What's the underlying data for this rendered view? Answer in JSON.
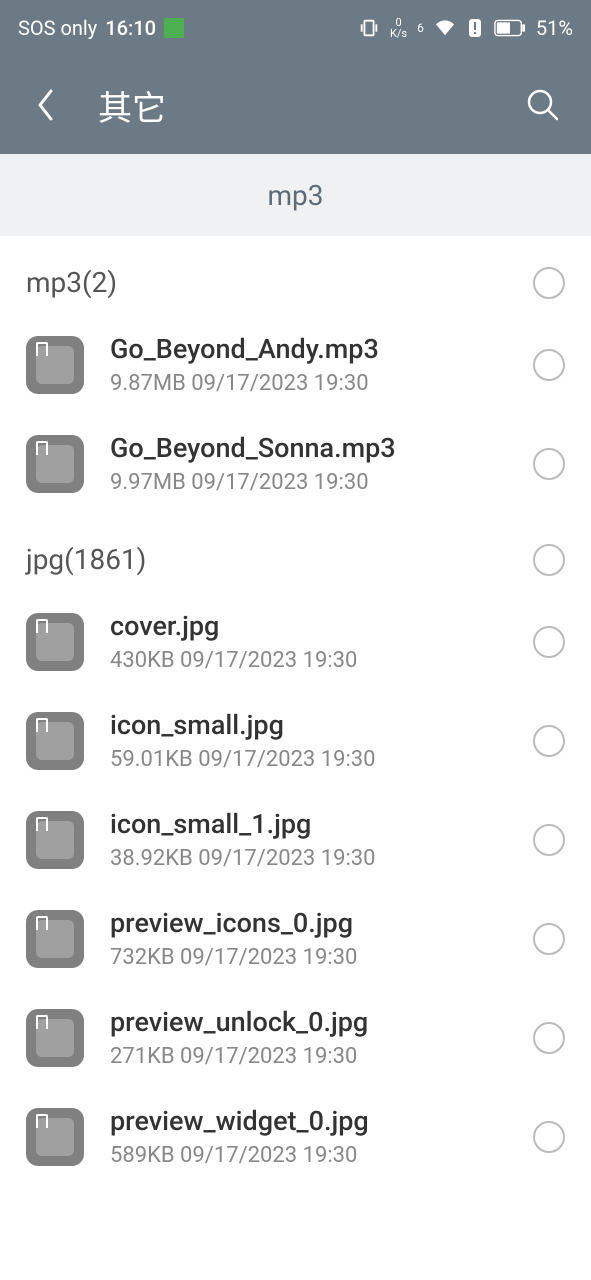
{
  "status_bar": {
    "network": "SOS only",
    "time": "16:10",
    "speed_top": "0",
    "speed_bottom": "K/s",
    "signal_count": "6",
    "battery": "51%"
  },
  "header": {
    "title": "其它"
  },
  "tab": {
    "active": "mp3"
  },
  "sections": [
    {
      "title": "mp3(2)",
      "files": [
        {
          "name": "Go_Beyond_Andy.mp3",
          "meta": "9.87MB 09/17/2023 19:30"
        },
        {
          "name": "Go_Beyond_Sonna.mp3",
          "meta": "9.97MB 09/17/2023 19:30"
        }
      ]
    },
    {
      "title": "jpg(1861)",
      "files": [
        {
          "name": "cover.jpg",
          "meta": "430KB 09/17/2023 19:30"
        },
        {
          "name": "icon_small.jpg",
          "meta": "59.01KB 09/17/2023 19:30"
        },
        {
          "name": "icon_small_1.jpg",
          "meta": "38.92KB 09/17/2023 19:30"
        },
        {
          "name": "preview_icons_0.jpg",
          "meta": "732KB 09/17/2023 19:30"
        },
        {
          "name": "preview_unlock_0.jpg",
          "meta": "271KB 09/17/2023 19:30"
        },
        {
          "name": "preview_widget_0.jpg",
          "meta": "589KB 09/17/2023 19:30"
        }
      ]
    }
  ]
}
